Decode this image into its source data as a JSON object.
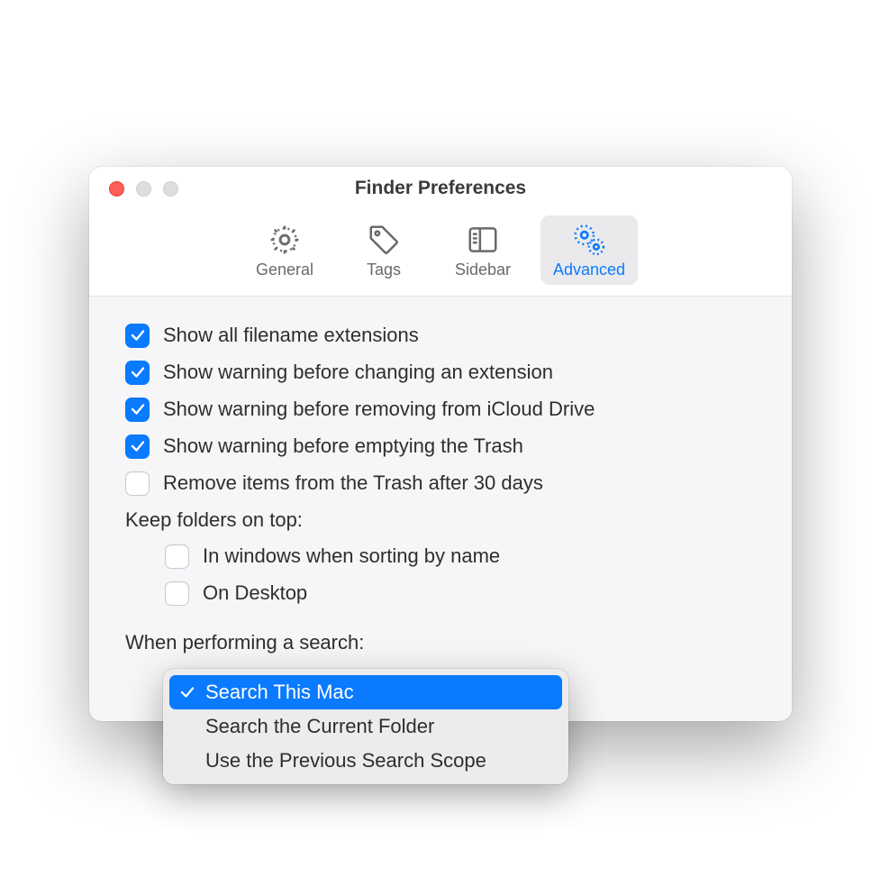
{
  "window": {
    "title": "Finder Preferences"
  },
  "toolbar": {
    "tabs": [
      {
        "label": "General",
        "active": false
      },
      {
        "label": "Tags",
        "active": false
      },
      {
        "label": "Sidebar",
        "active": false
      },
      {
        "label": "Advanced",
        "active": true
      }
    ]
  },
  "options": {
    "show_extensions": {
      "label": "Show all filename extensions",
      "checked": true
    },
    "warn_change_ext": {
      "label": "Show warning before changing an extension",
      "checked": true
    },
    "warn_icloud": {
      "label": "Show warning before removing from iCloud Drive",
      "checked": true
    },
    "warn_trash": {
      "label": "Show warning before emptying the Trash",
      "checked": true
    },
    "remove_30days": {
      "label": "Remove items from the Trash after 30 days",
      "checked": false
    }
  },
  "keep_folders": {
    "label": "Keep folders on top:",
    "in_windows": {
      "label": "In windows when sorting by name",
      "checked": false
    },
    "on_desktop": {
      "label": "On Desktop",
      "checked": false
    }
  },
  "search": {
    "label": "When performing a search:",
    "options": [
      {
        "label": "Search This Mac",
        "selected": true
      },
      {
        "label": "Search the Current Folder",
        "selected": false
      },
      {
        "label": "Use the Previous Search Scope",
        "selected": false
      }
    ]
  }
}
